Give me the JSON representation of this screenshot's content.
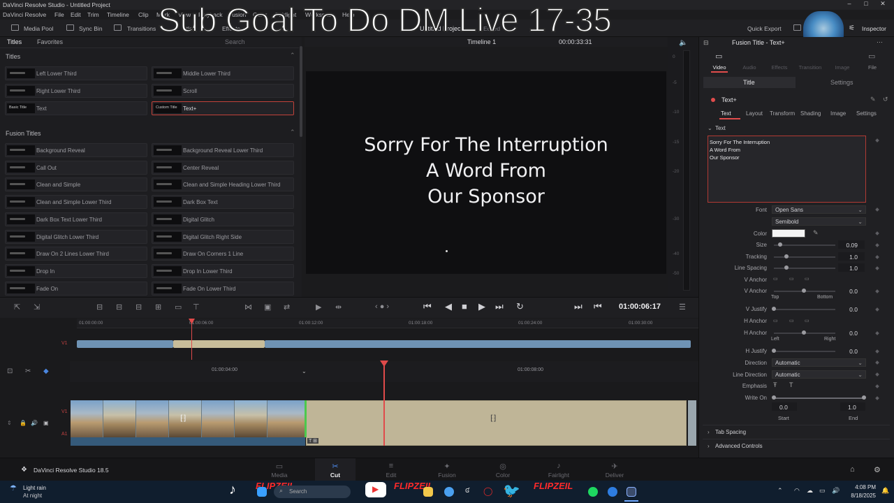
{
  "window": {
    "title": "DaVinci Resolve Studio - Untitled Project"
  },
  "menu": [
    "DaVinci Resolve",
    "File",
    "Edit",
    "Trim",
    "Timeline",
    "Clip",
    "Mark",
    "View",
    "Playback",
    "Fusion",
    "Color",
    "Fairlight",
    "Workspace",
    "Help"
  ],
  "toolbar": {
    "media_pool": "Media Pool",
    "sync_bin": "Sync Bin",
    "transitions": "Transitions",
    "titles": "Titles",
    "effects": "Effects",
    "project_name": "Untitled Project",
    "edited": "Edited",
    "quick_export": "Quick Export",
    "inspector": "Inspector"
  },
  "stream_overlay": "Sub Goal To Do DM Live 17-35",
  "left_panel": {
    "tabs": [
      "Titles",
      "Favorites"
    ],
    "search_placeholder": "Search",
    "titles_header": "Titles",
    "titles": [
      {
        "label": "Left Lower Third",
        "thumb": ""
      },
      {
        "label": "Middle Lower Third",
        "thumb": ""
      },
      {
        "label": "Right Lower Third",
        "thumb": ""
      },
      {
        "label": "Scroll",
        "thumb": ""
      },
      {
        "label": "Text",
        "thumb": "Basic Title"
      },
      {
        "label": "Text+",
        "thumb": "Custom Title"
      }
    ],
    "fusion_header": "Fusion Titles",
    "fusion_titles": [
      "Background Reveal",
      "Background Reveal Lower Third",
      "Call Out",
      "Center Reveal",
      "Clean and Simple",
      "Clean and Simple Heading Lower Third",
      "Clean and Simple Lower Third",
      "Dark Box Text",
      "Dark Box Text Lower Third",
      "Digital Glitch",
      "Digital Glitch Lower Third",
      "Digital Glitch Right Side",
      "Draw On 2 Lines Lower Third",
      "Draw On Corners 1 Line",
      "Drop In",
      "Drop In Lower Third",
      "Fade On",
      "Fade On Lower Third"
    ]
  },
  "viewer": {
    "timeline_name": "Timeline 1",
    "duration": "00:00:33:31",
    "lines": [
      "Sorry For The Interruption",
      "A Word From",
      "Our Sponsor"
    ],
    "meter_scale": [
      "0",
      "-5",
      "-10",
      "-15",
      "-20",
      "-30",
      "-40",
      "-50"
    ]
  },
  "transport": {
    "timecode": "01:00:06:17"
  },
  "upper_timeline": {
    "ticks": [
      "01:00:00:00",
      "01:00:06:00",
      "01:00:12:00",
      "01:00:18:00",
      "01:00:24:00",
      "01:00:30:00"
    ],
    "track": "V1"
  },
  "lower_timeline": {
    "ticks": [
      "01:00:04:00",
      "01:00:08:00"
    ],
    "tracks": [
      "V1",
      "A1"
    ]
  },
  "inspector": {
    "clip_title": "Fusion Title - Text+",
    "top_tabs": [
      "Video",
      "Audio",
      "Effects",
      "Transition",
      "Image",
      "File"
    ],
    "sub_tabs": [
      "Title",
      "Settings"
    ],
    "tool_name": "Text+",
    "tool_tabs": [
      "Text",
      "Layout",
      "Transform",
      "Shading",
      "Image",
      "Settings"
    ],
    "section_text": "Text",
    "text_lines": [
      "Sorry For The Interruption",
      "A Word From",
      "Our Sponsor"
    ],
    "font_label": "Font",
    "font": "Open Sans",
    "style": "Semibold",
    "color_label": "Color",
    "color_value": "#f4f4f4",
    "size_label": "Size",
    "size": "0.09",
    "size_fraction": 0.1,
    "tracking_label": "Tracking",
    "tracking": "1.0",
    "tracking_fraction": 0.2,
    "line_spacing_label": "Line Spacing",
    "line_spacing": "1.0",
    "line_spacing_fraction": 0.2,
    "v_anchor_label": "V Anchor",
    "v_anchor": "0.0",
    "v_anchor_top": "Top",
    "v_anchor_bottom": "Bottom",
    "v_justify_label": "V Justify",
    "v_justify": "0.0",
    "h_anchor_label": "H Anchor",
    "h_anchor": "0.0",
    "h_anchor_left": "Left",
    "h_anchor_right": "Right",
    "h_justify_label": "H Justify",
    "h_justify": "0.0",
    "direction_label": "Direction",
    "direction": "Automatic",
    "line_direction_label": "Line Direction",
    "line_direction": "Automatic",
    "emphasis_label": "Emphasis",
    "write_on_label": "Write On",
    "write_on_start": "0.0",
    "write_on_end": "1.0",
    "start_label": "Start",
    "end_label": "End",
    "tab_spacing": "Tab Spacing",
    "advanced_controls": "Advanced Controls"
  },
  "pages": {
    "app_name": "DaVinci Resolve Studio 18.5",
    "items": [
      "Media",
      "Cut",
      "Edit",
      "Fusion",
      "Color",
      "Fairlight",
      "Deliver"
    ],
    "active": "Cut"
  },
  "taskbar": {
    "weather_line1": "Light rain",
    "weather_line2": "At night",
    "search": "Search",
    "overlay_tag": "FLIPZEIL",
    "time": "4:08 PM",
    "date": "8/18/2025"
  }
}
